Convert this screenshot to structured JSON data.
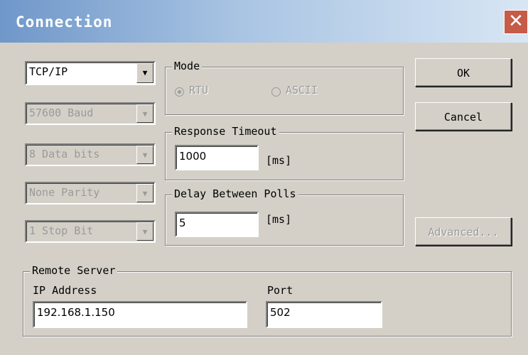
{
  "window": {
    "title": "Connection",
    "close_glyph": "✕"
  },
  "protocol": {
    "selected": "TCP/IP"
  },
  "serial": {
    "baud": "57600 Baud",
    "data_bits": "8 Data bits",
    "parity": "None Parity",
    "stop_bits": "1 Stop Bit"
  },
  "mode": {
    "label": "Mode",
    "options": [
      "RTU",
      "ASCII"
    ],
    "selected": "RTU"
  },
  "response_timeout": {
    "label": "Response Timeout",
    "value": "1000",
    "unit": "[ms]"
  },
  "delay_between_polls": {
    "label": "Delay Between Polls",
    "value": "5",
    "unit": "[ms]"
  },
  "buttons": {
    "ok": "OK",
    "cancel": "Cancel",
    "advanced": "Advanced..."
  },
  "remote_server": {
    "label": "Remote Server",
    "ip_label": "IP Address",
    "ip_value": "192.168.1.150",
    "port_label": "Port",
    "port_value": "502"
  }
}
